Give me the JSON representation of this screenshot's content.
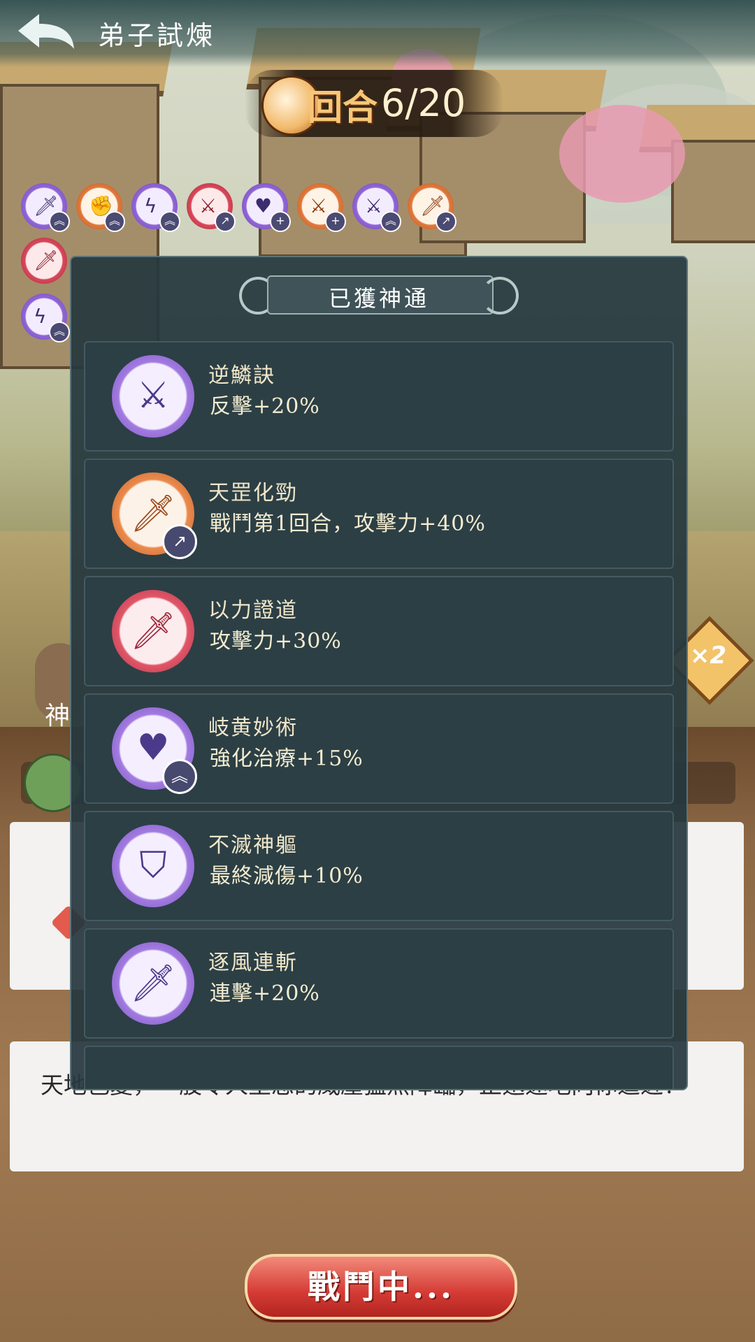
{
  "header": {
    "title": "弟子試煉",
    "round_label": "回合",
    "round_count": "6/20"
  },
  "buffs_row1": [
    {
      "color": "purple",
      "icon": "flame-sword-icon",
      "badge": "upgrade"
    },
    {
      "color": "orange",
      "icon": "fist-icon",
      "badge": "upgrade"
    },
    {
      "color": "purple",
      "icon": "lightning-sword-icon",
      "badge": "upgrade"
    },
    {
      "color": "red",
      "icon": "crossed-swords-icon",
      "badge": "arrow"
    },
    {
      "color": "purple",
      "icon": "heart-plus-icon",
      "badge": "plus"
    },
    {
      "color": "orange",
      "icon": "crossed-swords-icon",
      "badge": "plus"
    },
    {
      "color": "purple",
      "icon": "dragon-sword-icon",
      "badge": "upgrade"
    },
    {
      "color": "orange",
      "icon": "sword-icon",
      "badge": "arrow"
    }
  ],
  "buffs_row2": [
    {
      "color": "red",
      "icon": "sword-icon",
      "badge": ""
    },
    {
      "color": "purple",
      "icon": "lightning-sword-icon",
      "badge": "upgrade"
    }
  ],
  "modal": {
    "title": "已獲神通",
    "skills": [
      {
        "name": "逆鱗訣",
        "desc": "反擊+20%",
        "color": "purple",
        "icon": "dragon-sword-icon",
        "badge": ""
      },
      {
        "name": "天罡化勁",
        "desc": "戰鬥第1回合，攻擊力+40%",
        "color": "orange",
        "icon": "sword-icon",
        "badge": "arrow"
      },
      {
        "name": "以力證道",
        "desc": "攻擊力+30%",
        "color": "red",
        "icon": "sword-icon",
        "badge": ""
      },
      {
        "name": "岐黄妙術",
        "desc": "強化治療+15%",
        "color": "purple",
        "icon": "heart-icon",
        "badge": "upgrade"
      },
      {
        "name": "不滅神軀",
        "desc": "最終減傷+10%",
        "color": "purple",
        "icon": "shield-icon",
        "badge": ""
      },
      {
        "name": "逐風連斬",
        "desc": "連擊+20%",
        "color": "purple",
        "icon": "flame-sword-icon",
        "badge": ""
      }
    ]
  },
  "log": {
    "message": "天地色變，一股令人窒息的威壓猛然降臨，正迅速地向你逼近！"
  },
  "side": {
    "speed_label": "×2",
    "side_tab_label": "神"
  },
  "battle_button": {
    "label": "戰鬥中..."
  },
  "colors": {
    "accent": "#d43b35",
    "modal_bg": "#26383e",
    "card_bg": "#2c3f45"
  }
}
